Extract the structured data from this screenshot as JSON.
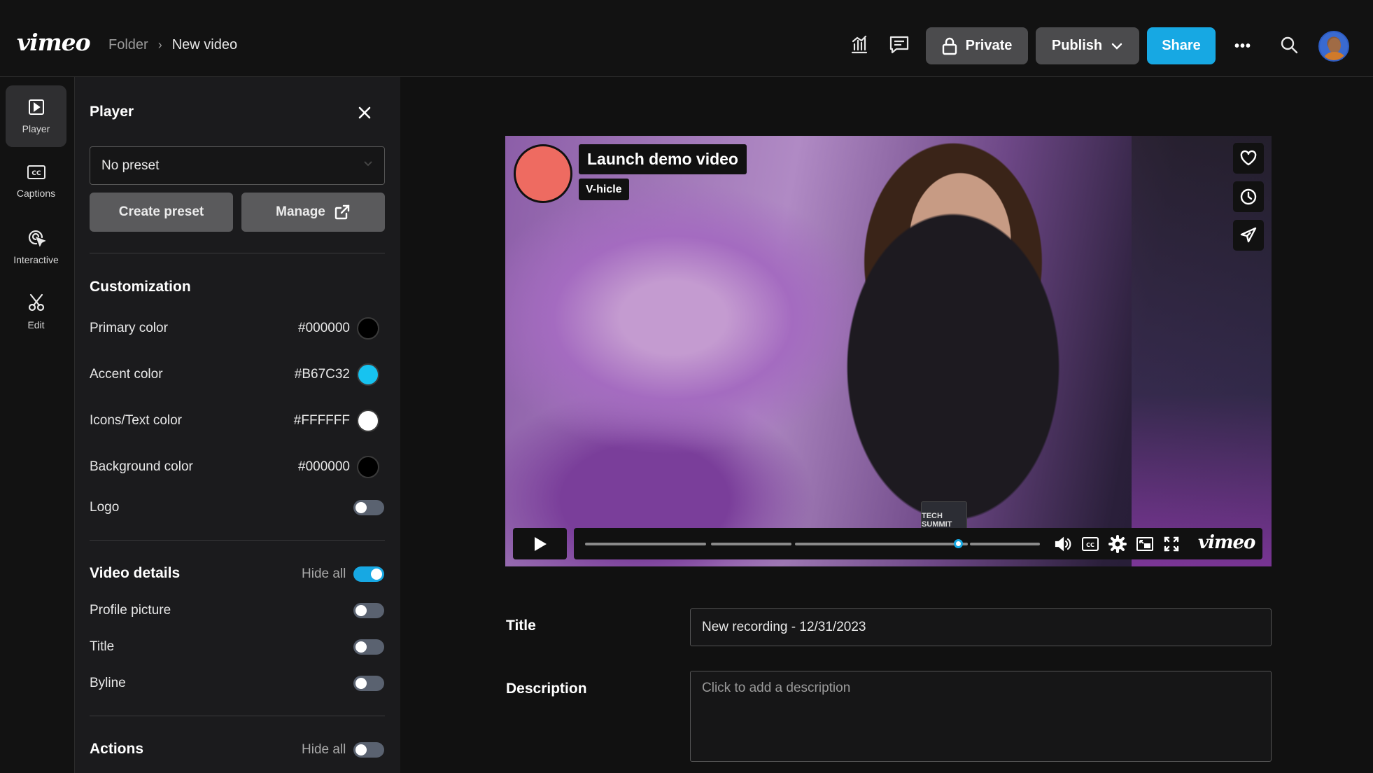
{
  "header": {
    "logo": "vimeo",
    "breadcrumb": {
      "folder": "Folder",
      "separator": "›",
      "current": "New video"
    },
    "private_label": "Private",
    "publish_label": "Publish",
    "share_label": "Share",
    "more_glyph": "•••"
  },
  "rail": {
    "items": [
      {
        "label": "Player",
        "icon": "player-icon",
        "active": true
      },
      {
        "label": "Captions",
        "icon": "captions-icon",
        "active": false
      },
      {
        "label": "Interactive",
        "icon": "interactive-icon",
        "active": false
      },
      {
        "label": "Edit",
        "icon": "scissors-icon",
        "active": false
      }
    ]
  },
  "panel": {
    "title": "Player",
    "preset_value": "No preset",
    "create_preset_label": "Create preset",
    "manage_label": "Manage",
    "customization": {
      "title": "Customization",
      "primary": {
        "label": "Primary color",
        "value": "#000000",
        "swatch": "#000000"
      },
      "accent": {
        "label": "Accent color",
        "value": "#B67C32",
        "swatch": "#17c3f0"
      },
      "icons": {
        "label": "Icons/Text color",
        "value": "#FFFFFF",
        "swatch": "#ffffff"
      },
      "background": {
        "label": "Background color",
        "value": "#000000",
        "swatch": "#000000"
      },
      "logo": {
        "label": "Logo",
        "on": false
      }
    },
    "video_details": {
      "title": "Video details",
      "hide_all_label": "Hide all",
      "hide_all_on": true,
      "profile_picture": {
        "label": "Profile picture",
        "on": false
      },
      "title_toggle": {
        "label": "Title",
        "on": false
      },
      "byline": {
        "label": "Byline",
        "on": false
      }
    },
    "actions": {
      "title": "Actions",
      "hide_all_label": "Hide all",
      "hide_all_on": false
    }
  },
  "video": {
    "title": "Launch demo video",
    "byline": "V-hicle",
    "badge_text": "TECH SUMMIT",
    "logo": "vimeo",
    "progress": 0.82,
    "accent": "#17a8e3"
  },
  "fields": {
    "title_label": "Title",
    "title_value": "New recording - 12/31/2023",
    "description_label": "Description",
    "description_placeholder": "Click to add a description"
  },
  "colors": {
    "share": "#17a8e3",
    "bg": "#111111",
    "panel": "#1b1b1d"
  }
}
